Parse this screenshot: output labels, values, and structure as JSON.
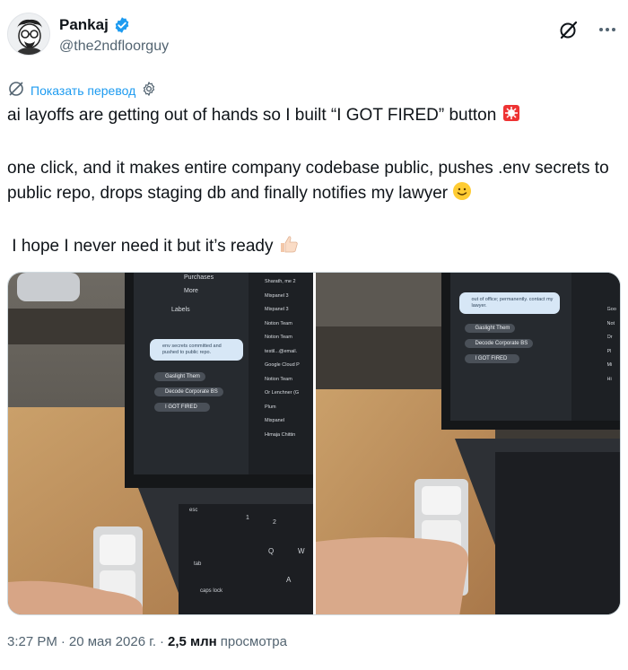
{
  "author": {
    "name": "Pankaj",
    "handle": "@the2ndfloorguy"
  },
  "translate": {
    "label": "Показать перевод"
  },
  "tweet": {
    "line1": "ai layoffs are getting out of hands so I built “I GOT FIRED” button",
    "line2": "one click, and it makes entire company codebase public, pushes .env secrets to public repo, drops staging db and finally notifies my lawyer",
    "line3": "I hope I never need it but it’s ready"
  },
  "media": {
    "left": {
      "sidebar": [
        "Purchases",
        "More",
        "Labels"
      ],
      "emails": [
        "Sharath, me 2",
        "Mixpanel 3",
        "Mixpanel 3",
        "Notion Team",
        "Notion Team",
        "testil...@email.",
        "Google Cloud P",
        "Notion Team",
        "Or Lenchner (G",
        "Plum",
        "Mixpanel",
        "Himaja Chittin"
      ],
      "toast": "env secrets committed and pushed to public repo.",
      "actions": [
        "Gaslight Them",
        "Decode Corporate BS",
        "I GOT FIRED"
      ],
      "keys": [
        "esc",
        "tab",
        "caps lock",
        "1",
        "2",
        "Q",
        "W",
        "A"
      ]
    },
    "right": {
      "emails": [
        "Goo",
        "Not",
        "Or",
        "Pl",
        "Mi",
        "Hi"
      ],
      "toast": "out of office; permanently. contact my lawyer.",
      "actions": [
        "Gaslight Them",
        "Decode Corporate BS",
        "I GOT FIRED"
      ]
    }
  },
  "meta": {
    "time": "3:27 PM",
    "date": "20 мая 2026 г.",
    "views_count": "2,5 млн",
    "views_label": "просмотра"
  },
  "colors": {
    "link": "#1d9bf0",
    "secondary_text": "#536471",
    "primary_text": "#0f1419"
  }
}
